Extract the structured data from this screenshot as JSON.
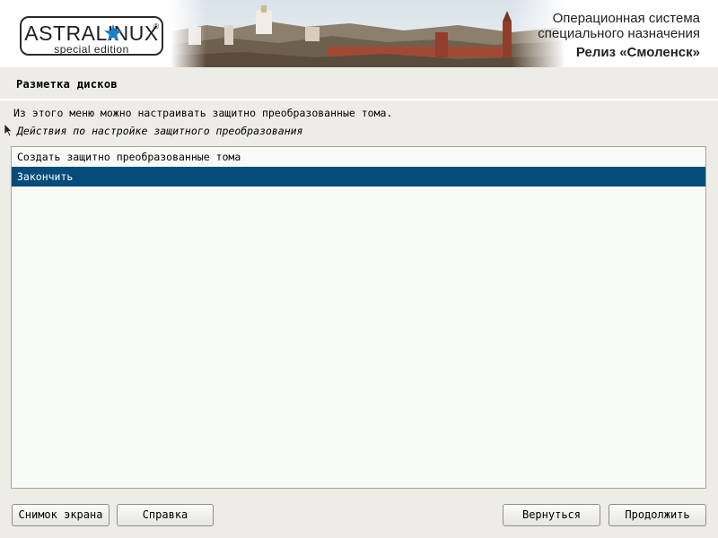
{
  "header": {
    "logo_main": "ASTRALINUX",
    "logo_sub": "special edition",
    "logo_registered": "®",
    "line1": "Операционная система",
    "line2": "специального назначения",
    "line3": "Релиз «Смоленск»"
  },
  "page": {
    "title": "Разметка дисков",
    "description": "Из этого меню можно настраивать защитно преобразованные тома.",
    "section_label": "Действия по настройке защитного преобразования"
  },
  "list": {
    "items": [
      {
        "label": "Создать защитно преобразованные тома",
        "selected": false
      },
      {
        "label": "Закончить",
        "selected": true
      }
    ]
  },
  "buttons": {
    "screenshot": "Снимок экрана",
    "help": "Справка",
    "back": "Вернуться",
    "continue": "Продолжить"
  },
  "colors": {
    "selection": "#064c7a",
    "background": "#edece6",
    "list_background": "#f7faf7"
  },
  "icons": {
    "logo_star": "star-icon",
    "pointer": "mouse-pointer-icon"
  }
}
